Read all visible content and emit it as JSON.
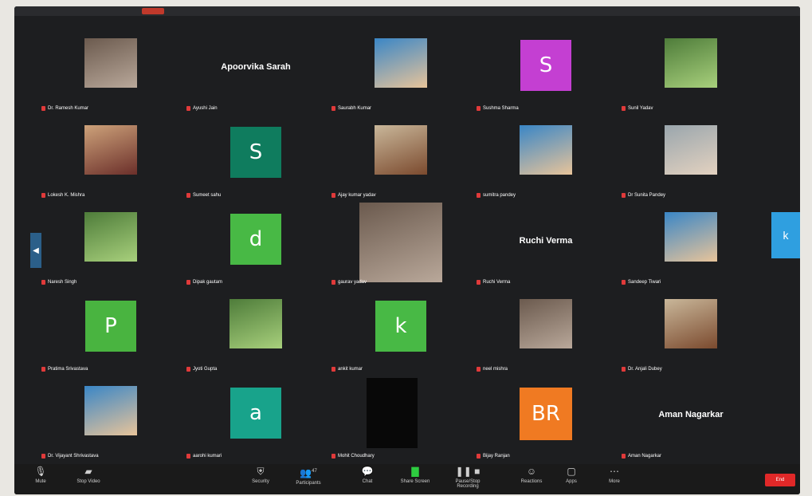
{
  "window": {
    "title": ""
  },
  "participants": [
    {
      "name": "Dr. Ramesh Kumar",
      "type": "photo",
      "display": ""
    },
    {
      "name": "Ayushi Jain",
      "type": "name",
      "display": "Apoorvika Sarah"
    },
    {
      "name": "Saurabh Kumar",
      "type": "photo",
      "display": ""
    },
    {
      "name": "Sushma Sharma",
      "type": "letter",
      "display": "S",
      "color": "#c43fd2"
    },
    {
      "name": "Sunil Yadav",
      "type": "photo",
      "display": ""
    },
    {
      "name": "Lokesh K. Mishra",
      "type": "photo",
      "display": ""
    },
    {
      "name": "Sumeet sahu",
      "type": "letter",
      "display": "S",
      "color": "#0f7c5e"
    },
    {
      "name": "Ajay kumar yadav",
      "type": "photo",
      "display": ""
    },
    {
      "name": "sumitra pandey",
      "type": "photo",
      "display": ""
    },
    {
      "name": "Dr Sunita Pandey",
      "type": "photo",
      "display": ""
    },
    {
      "name": "Naresh Singh",
      "type": "photo",
      "display": ""
    },
    {
      "name": "Dipak gautam",
      "type": "letter",
      "display": "d",
      "color": "#48b945"
    },
    {
      "name": "gaurav yadav",
      "type": "photo",
      "display": ""
    },
    {
      "name": "Ruchi Verma",
      "type": "name",
      "display": "Ruchi Verma"
    },
    {
      "name": "Sandeep Tiwari",
      "type": "photo",
      "display": ""
    },
    {
      "name": "Pratima Srivastava",
      "type": "letter",
      "display": "P",
      "color": "#49b440"
    },
    {
      "name": "Jyoti Gupta",
      "type": "photo",
      "display": ""
    },
    {
      "name": "ankit kumar",
      "type": "letter",
      "display": "k",
      "color": "#48b945"
    },
    {
      "name": "neel mishra",
      "type": "photo",
      "display": ""
    },
    {
      "name": "Dr. Anjali Dubey",
      "type": "photo",
      "display": ""
    },
    {
      "name": "Dr. Vijayant Shrivastava",
      "type": "photo",
      "display": ""
    },
    {
      "name": "aarohi kumari",
      "type": "letter",
      "display": "a",
      "color": "#18a38b"
    },
    {
      "name": "Mohit Choudhary",
      "type": "video",
      "display": ""
    },
    {
      "name": "Bijay Ranjan",
      "type": "letter",
      "display": "BR",
      "color": "#f07a22"
    },
    {
      "name": "Aman Nagarkar",
      "type": "name",
      "display": "Aman Nagarkar"
    }
  ],
  "side_tile": {
    "label": "k"
  },
  "toolbar": {
    "mute": "Mute",
    "stop_video": "Stop Video",
    "security": "Security",
    "participants": "Participants",
    "participant_count": "47",
    "chat": "Chat",
    "share_screen": "Share Screen",
    "record": "Pause/Stop Recording",
    "reactions": "Reactions",
    "apps": "Apps",
    "more": "More",
    "end": "End"
  },
  "colors": {
    "background": "#1d1e20",
    "toolbar": "#1a1a1a",
    "end": "#e02828"
  }
}
